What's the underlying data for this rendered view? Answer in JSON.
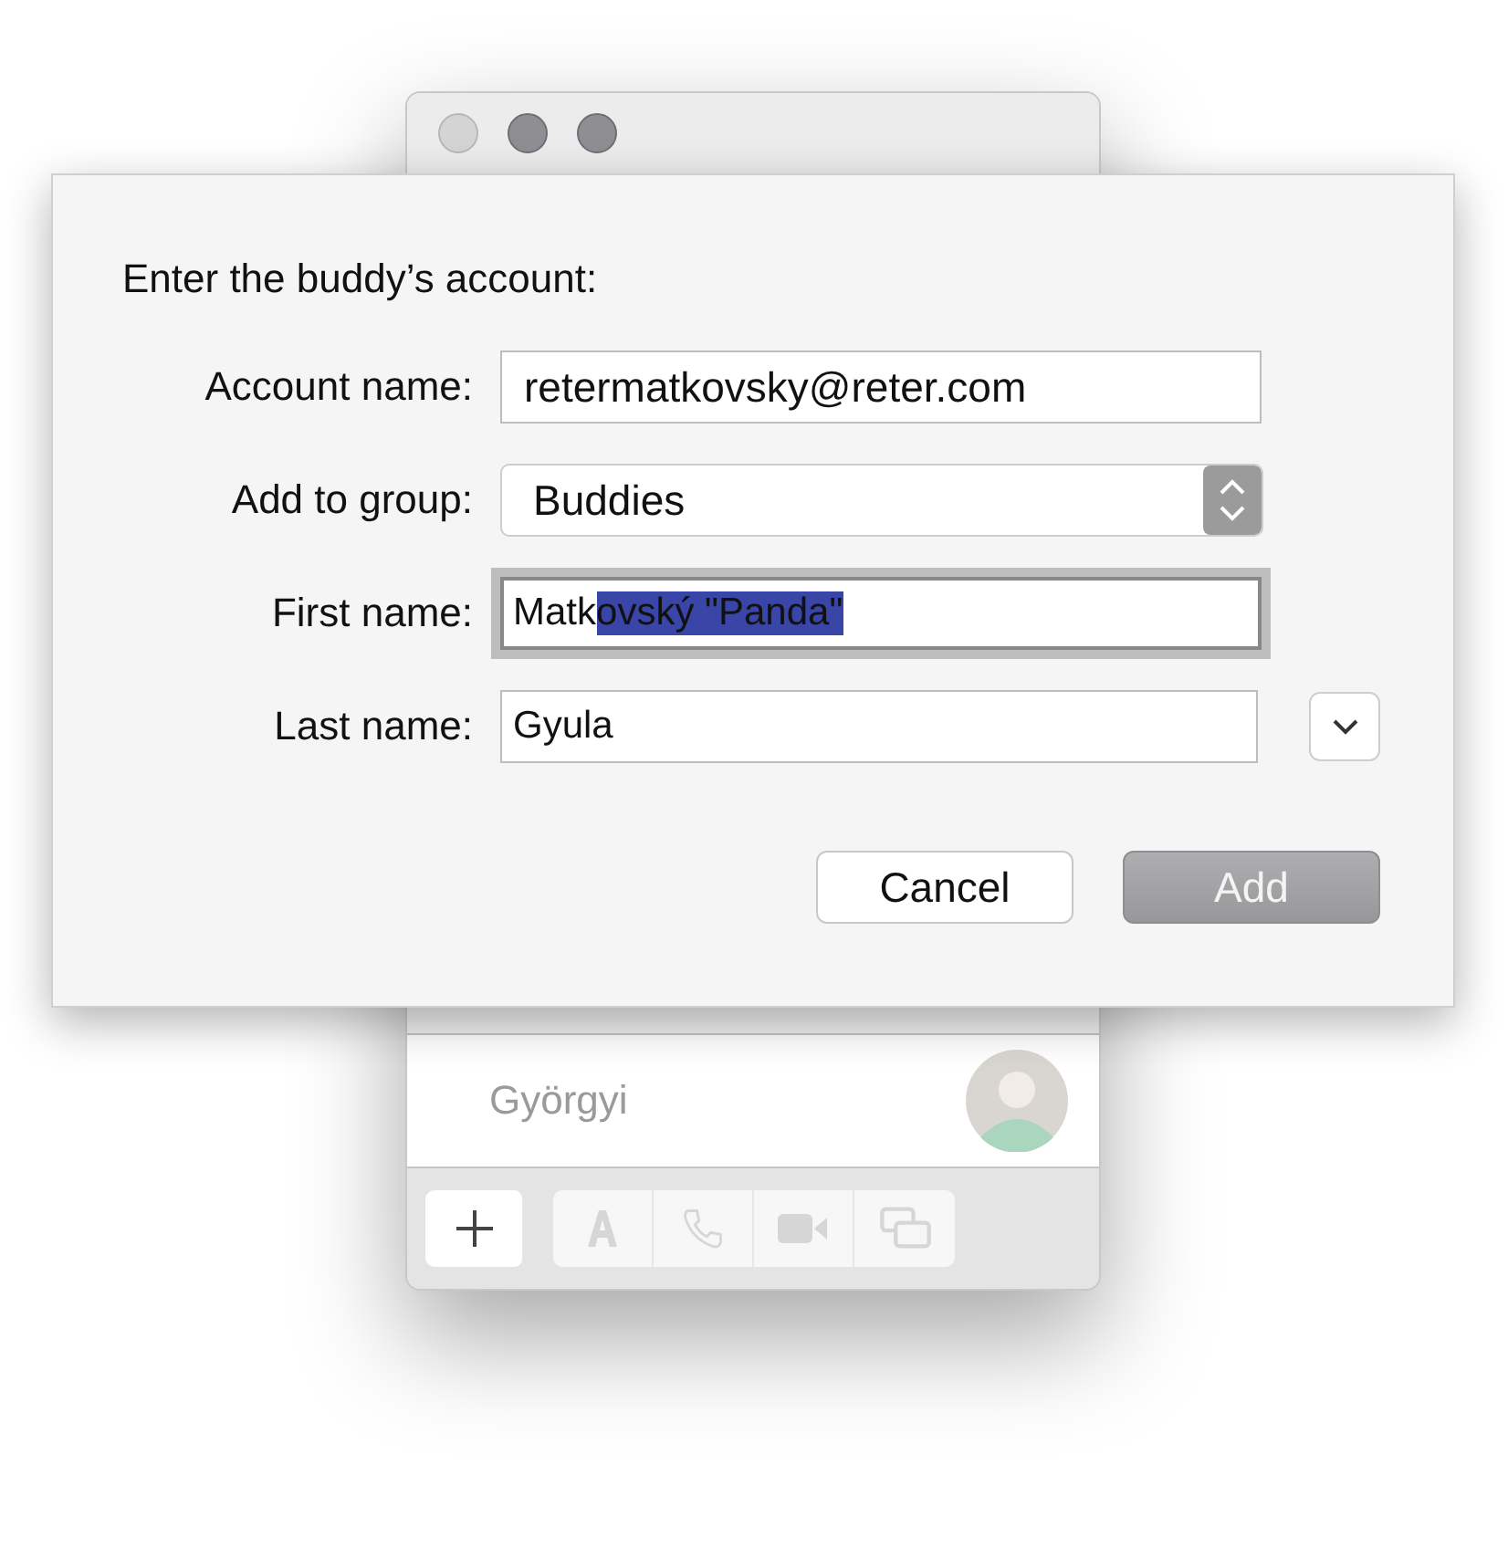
{
  "back_window": {
    "traffic_lights": [
      {
        "disabled": true
      },
      {
        "disabled": false
      },
      {
        "disabled": false
      }
    ],
    "contacts": [
      {
        "name": "Györgyi",
        "dimmed": true
      }
    ],
    "toolbar": [
      {
        "kind": "add",
        "disabled": false
      },
      {
        "kind": "text",
        "disabled": true
      },
      {
        "kind": "phone",
        "disabled": true
      },
      {
        "kind": "video",
        "disabled": true
      },
      {
        "kind": "screen",
        "disabled": true
      }
    ]
  },
  "sheet": {
    "prompt": "Enter the buddy’s account:",
    "fields": [
      {
        "kind": "text",
        "label": "Account name:",
        "value": "retermatkovsky@reter.com"
      },
      {
        "kind": "popup",
        "label": "Add to group:",
        "value": "Buddies"
      },
      {
        "kind": "text",
        "label": "First name:",
        "value": "Matk",
        "selected_text": "ovský \"Panda\"",
        "focused": true
      },
      {
        "kind": "text",
        "label": "Last name:",
        "value": "Gyula",
        "disclosure": true
      }
    ],
    "buttons": [
      {
        "label": "Cancel",
        "disabled": false
      },
      {
        "label": "Add",
        "disabled": true
      }
    ]
  }
}
